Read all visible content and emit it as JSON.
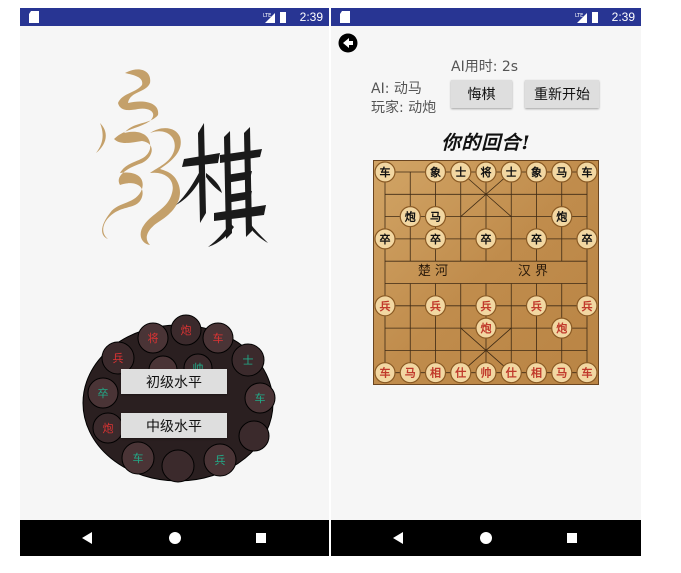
{
  "status_bar": {
    "time": "2:39",
    "network": "LTE"
  },
  "home": {
    "buttons": [
      {
        "label": "初级水平"
      },
      {
        "label": "中级水平"
      }
    ]
  },
  "game": {
    "ai_time": "AI用时: 2s",
    "ai_move": "AI: 动马",
    "player_move": "玩家: 动炮",
    "undo_label": "悔棋",
    "restart_label": "重新开始",
    "turn_text": "你的回合!",
    "river_left": "楚 河",
    "river_right": "汉 界",
    "pieces": {
      "top_row": [
        "车",
        "马",
        "象",
        "士",
        "将",
        "士",
        "象",
        "马",
        "车"
      ],
      "top_cannons": [
        "炮",
        "炮"
      ],
      "top_soldiers": [
        "卒",
        "卒",
        "卒",
        "卒",
        "卒"
      ],
      "bottom_soldiers": [
        "兵",
        "兵",
        "兵",
        "兵",
        "兵"
      ],
      "bottom_cannons": [
        "炮",
        "炮"
      ],
      "bottom_row": [
        "车",
        "马",
        "相",
        "仕",
        "帅",
        "仕",
        "相",
        "马",
        "车"
      ]
    }
  },
  "colors": {
    "status_bar": "#283593",
    "nav_bar": "#000000",
    "board": "#c99a5b",
    "red": "#c0392b",
    "black": "#111111"
  }
}
